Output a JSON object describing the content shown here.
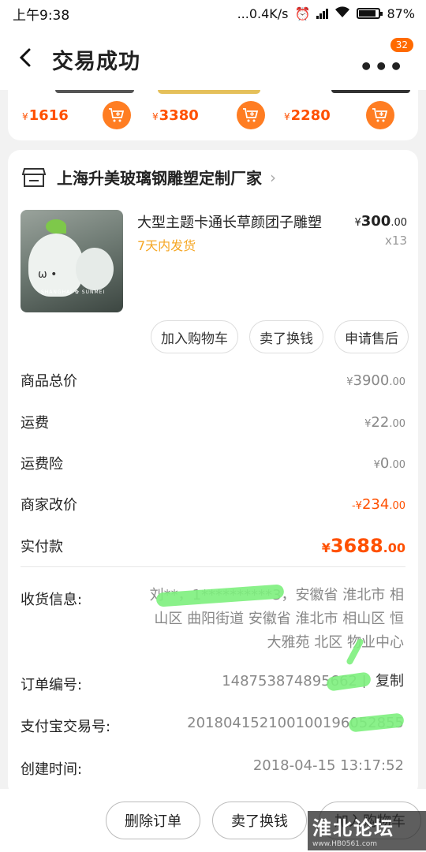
{
  "status_bar": {
    "time": "上午9:38",
    "speed": "...0.4K/s",
    "battery": "87%",
    "battery_level": 0.87
  },
  "nav": {
    "title": "交易成功",
    "badge": "32"
  },
  "recommend": [
    {
      "currency": "¥",
      "price": "1616"
    },
    {
      "currency": "¥",
      "price": "3380"
    },
    {
      "currency": "¥",
      "price": "2280"
    }
  ],
  "shop": {
    "name": "上海升美玻璃钢雕塑定制厂家"
  },
  "product": {
    "title": "大型主题卡通长草颜团子雕塑",
    "shipping": "7天内发货",
    "currency": "¥",
    "price_int": "300",
    "price_dec": ".00",
    "qty": "x13",
    "thumb_caption": "SHANGHAI ✿ SUNMEI"
  },
  "actions": {
    "add_cart": "加入购物车",
    "resell": "卖了换钱",
    "after_sale": "申请售后"
  },
  "summary": {
    "total_label": "商品总价",
    "total_int": "3900",
    "shipping_label": "运费",
    "shipping_int": "22",
    "insurance_label": "运费险",
    "insurance_int": "0",
    "adjust_label": "商家改价",
    "adjust_prefix": "-¥",
    "adjust_int": "234",
    "paid_label": "实付款",
    "paid_int": "3688",
    "currency": "¥",
    "dec": ".00"
  },
  "info": {
    "address_label": "收货信息:",
    "address_value": "刘**，1**********3，安徽省 淮北市 相山区 曲阳街道 安徽省 淮北市 相山区 恒大雅苑 北区 物业中心",
    "order_no_label": "订单编号:",
    "order_no": "148753874895662",
    "copy": "复制",
    "alipay_label": "支付宝交易号:",
    "alipay_no": "201804152100100196052855",
    "created_label": "创建时间:",
    "created": "2018-04-15 13:17:52"
  },
  "bottom": {
    "delete": "删除订单",
    "resell": "卖了换钱",
    "add_cart": "加入购物车"
  },
  "watermark": {
    "title": "淮北论坛",
    "url": "www.HB0561.com"
  }
}
